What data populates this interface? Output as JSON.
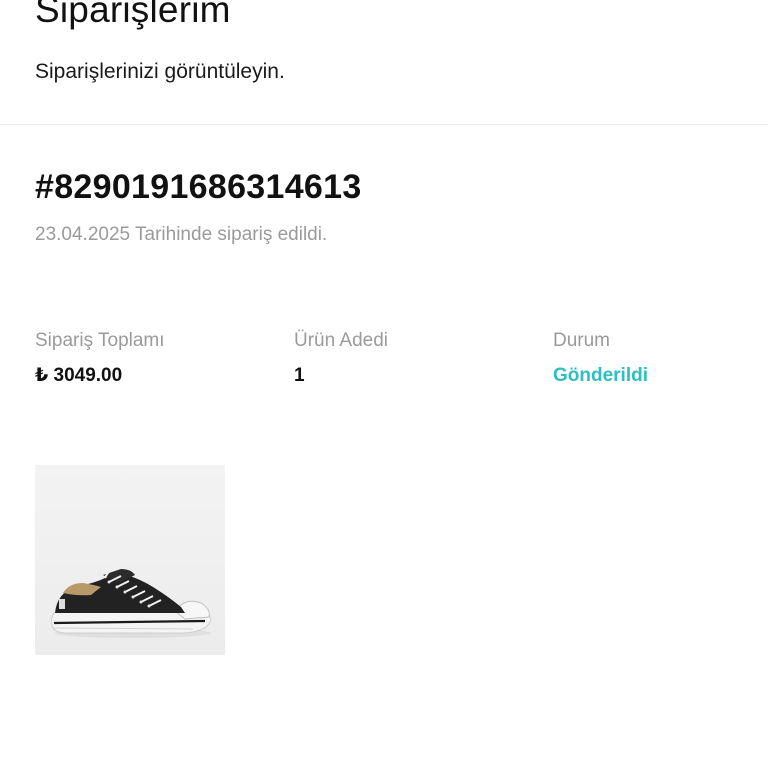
{
  "header": {
    "title": "Siparişlerim",
    "subtitle": "Siparişlerinizi görüntüleyin."
  },
  "order": {
    "number": "#8290191686314613",
    "date_text": "23.04.2025 Tarihinde sipariş edildi.",
    "stats": {
      "total_label": "Sipariş Toplamı",
      "total_value": "₺ 3049.00",
      "count_label": "Ürün Adedi",
      "count_value": "1",
      "status_label": "Durum",
      "status_value": "Gönderildi"
    },
    "items": [
      {
        "image_icon": "sneaker-image"
      }
    ]
  },
  "colors": {
    "status": "#2bbfc4",
    "muted": "#9a9a9a",
    "text": "#111111"
  }
}
